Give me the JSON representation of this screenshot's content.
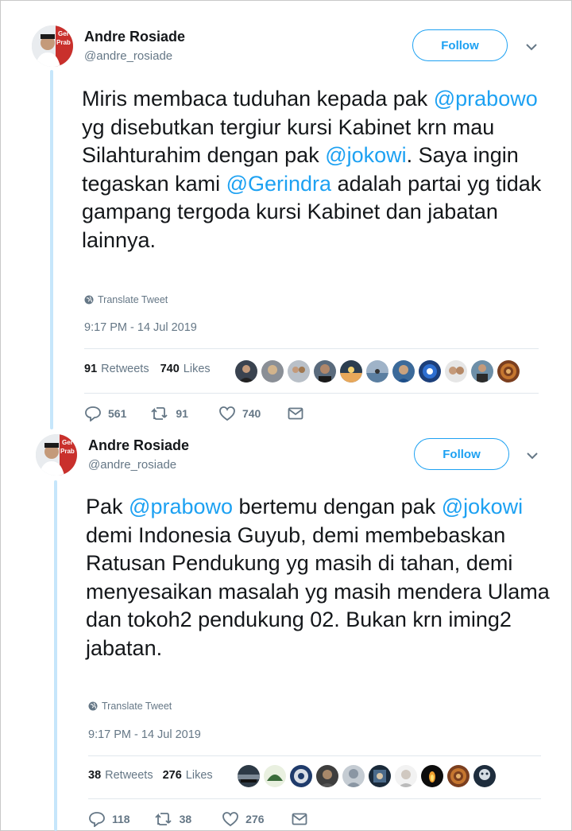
{
  "colors": {
    "accent": "#1da1f2",
    "muted": "#657786",
    "text": "#14171a",
    "thread": "#c6e6fb"
  },
  "tweets": [
    {
      "author": {
        "name": "Andre Rosiade",
        "handle": "@andre_rosiade"
      },
      "follow_label": "Follow",
      "text_parts": [
        {
          "t": "Miris membaca tuduhan kepada pak ",
          "m": false
        },
        {
          "t": "@prabowo",
          "m": true
        },
        {
          "t": " yg disebutkan tergiur kursi Kabinet krn mau Silahturahim dengan pak ",
          "m": false
        },
        {
          "t": "@jokowi",
          "m": true
        },
        {
          "t": ". Saya ingin tegaskan kami ",
          "m": false
        },
        {
          "t": "@Gerindra",
          "m": true
        },
        {
          "t": " adalah partai yg tidak gampang tergoda kursi Kabinet dan jabatan lainnya.",
          "m": false
        }
      ],
      "translate_label": "Translate Tweet",
      "timestamp": "9:17 PM - 14 Jul 2019",
      "retweets_count": "91",
      "retweets_label": "Retweets",
      "likes_count": "740",
      "likes_label": "Likes",
      "actions": {
        "replies": "561",
        "retweets": "91",
        "likes": "740"
      }
    },
    {
      "author": {
        "name": "Andre Rosiade",
        "handle": "@andre_rosiade"
      },
      "follow_label": "Follow",
      "text_parts": [
        {
          "t": "Pak ",
          "m": false
        },
        {
          "t": "@prabowo",
          "m": true
        },
        {
          "t": " bertemu dengan pak ",
          "m": false
        },
        {
          "t": "@jokowi",
          "m": true
        },
        {
          "t": " demi Indonesia Guyub, demi membebaskan Ratusan Pendukung yg masih di tahan, demi menyesaikan masalah yg masih mendera Ulama dan tokoh2 pendukung 02. Bukan krn iming2 jabatan.",
          "m": false
        }
      ],
      "translate_label": "Translate Tweet",
      "timestamp": "9:17 PM - 14 Jul 2019",
      "retweets_count": "38",
      "retweets_label": "Retweets",
      "likes_count": "276",
      "likes_label": "Likes",
      "actions": {
        "replies": "118",
        "retweets": "38",
        "likes": "276"
      }
    }
  ]
}
